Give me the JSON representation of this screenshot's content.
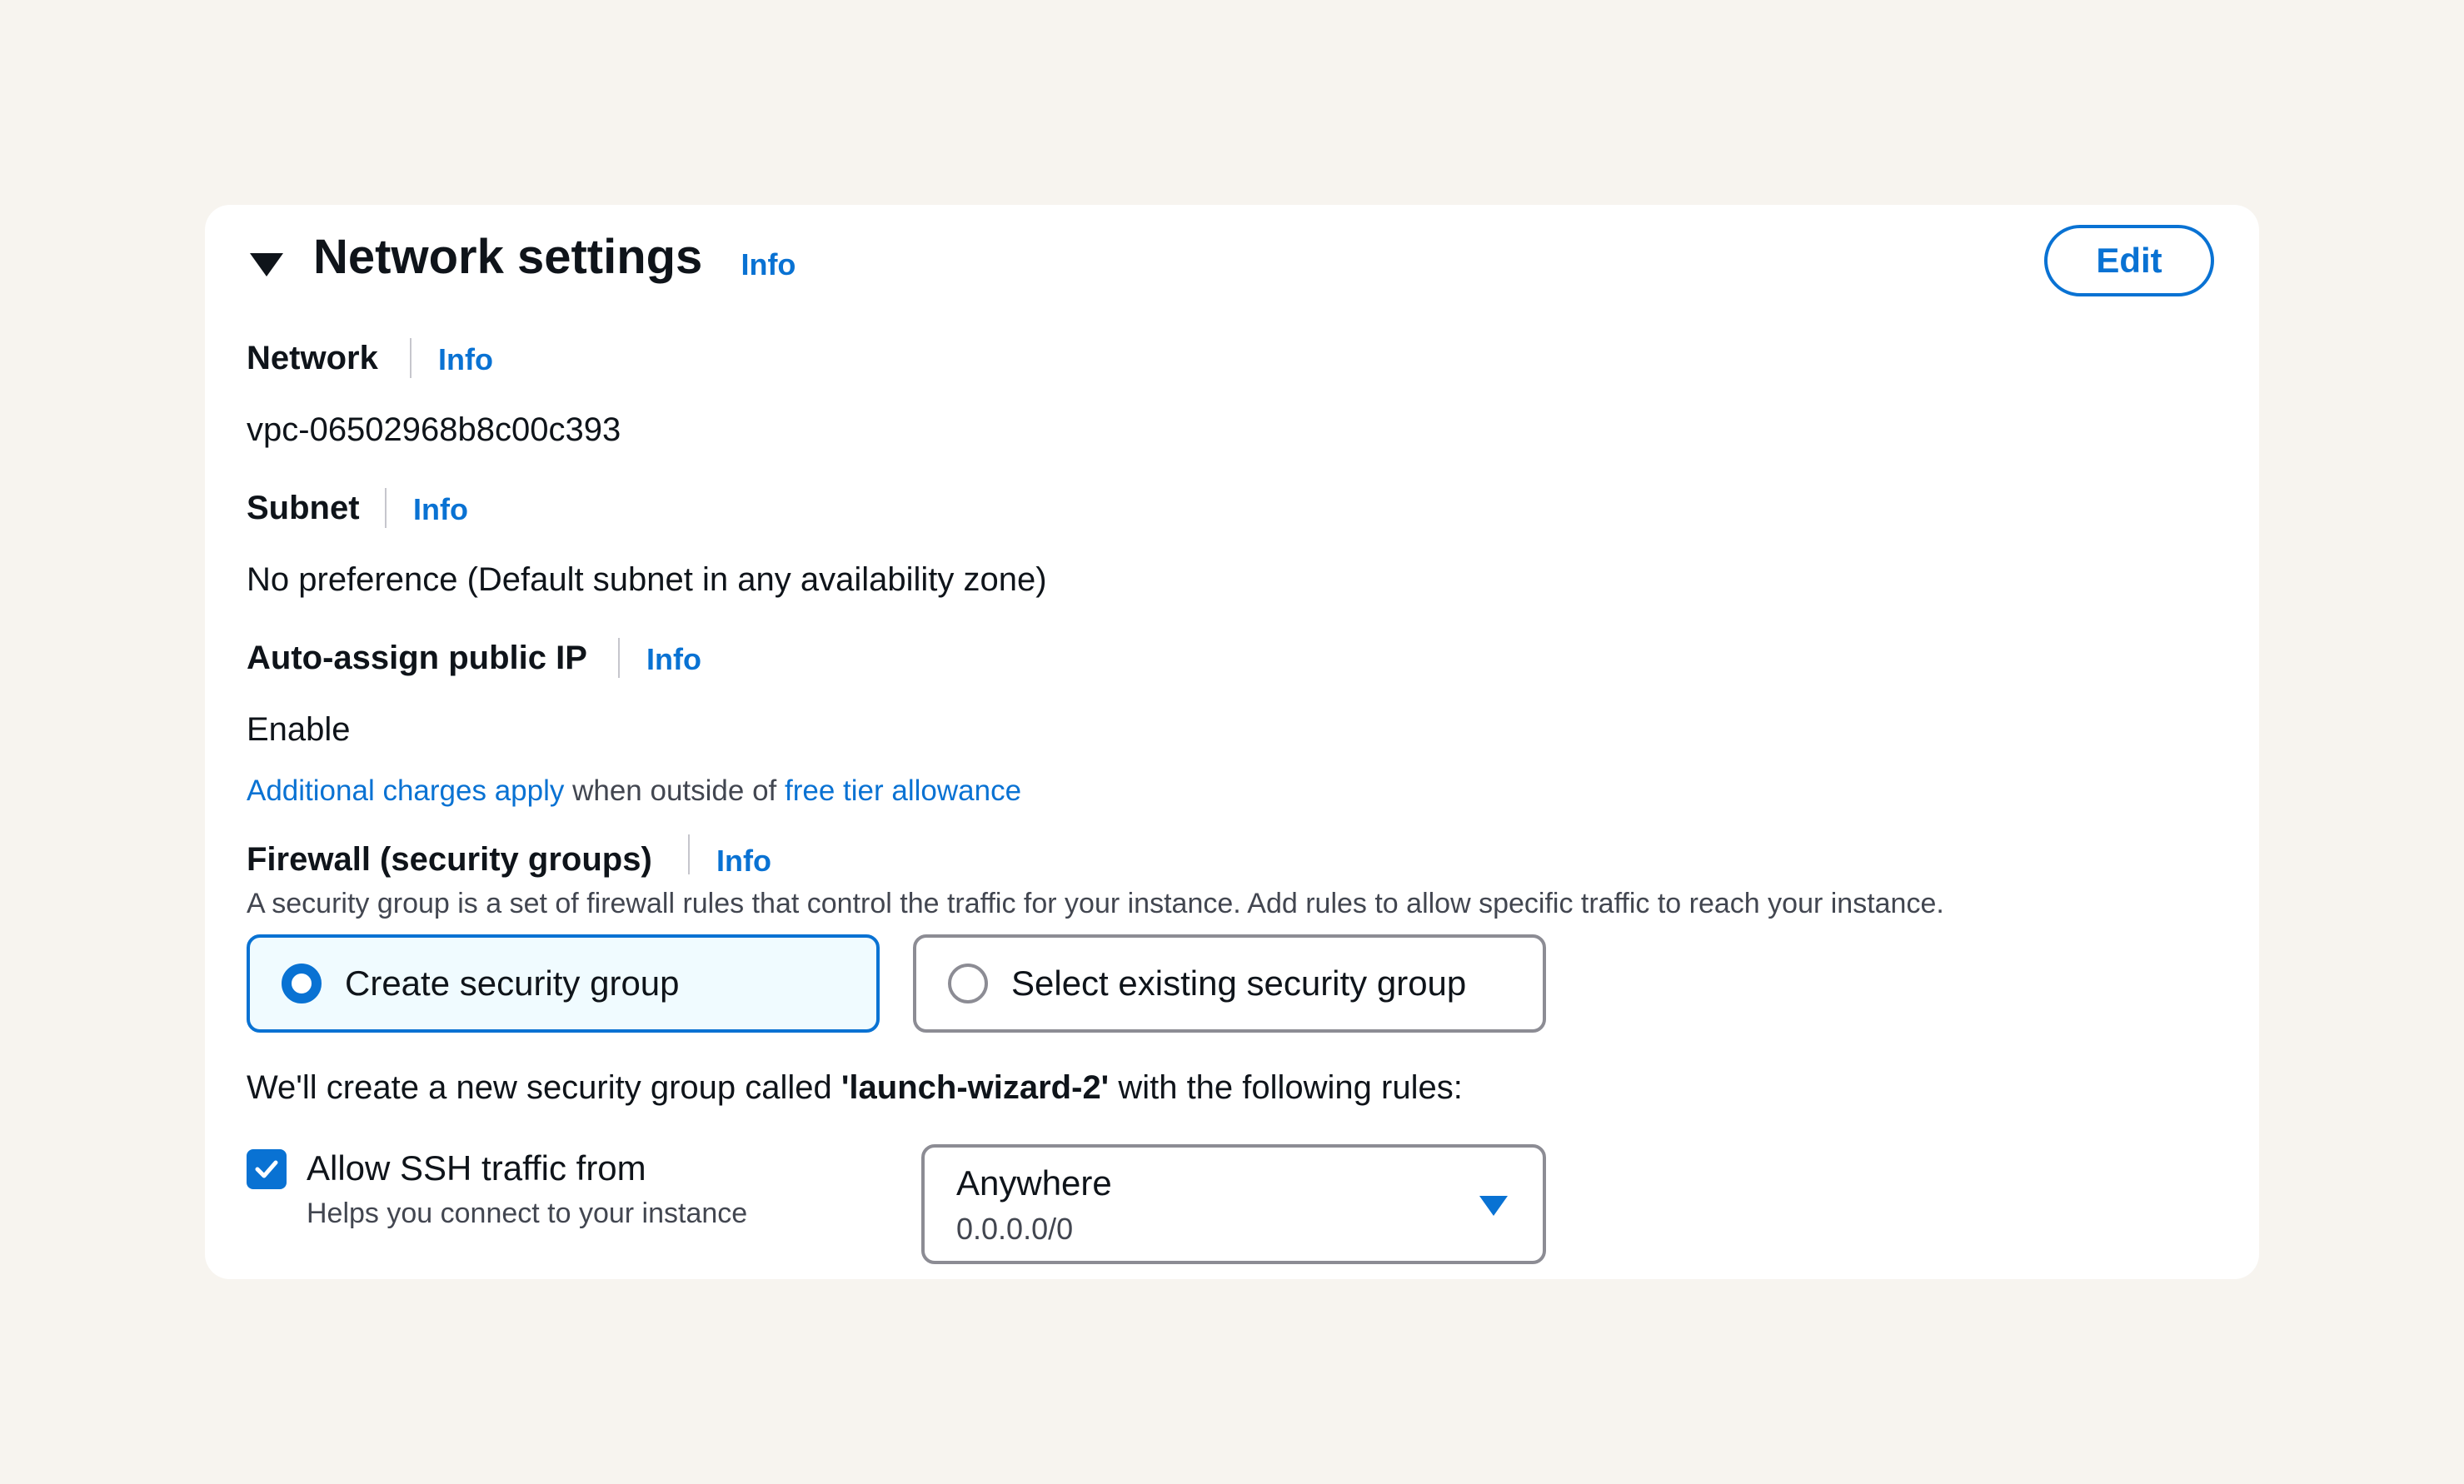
{
  "header": {
    "title": "Network settings",
    "info": "Info",
    "edit_label": "Edit"
  },
  "network": {
    "label": "Network",
    "info": "Info",
    "value": "vpc-06502968b8c00c393"
  },
  "subnet": {
    "label": "Subnet",
    "info": "Info",
    "value": "No preference (Default subnet in any availability zone)"
  },
  "public_ip": {
    "label": "Auto-assign public IP",
    "info": "Info",
    "value": "Enable",
    "charges_link": "Additional charges apply",
    "charges_text": " when outside of ",
    "free_tier_link": "free tier allowance"
  },
  "firewall": {
    "label": "Firewall (security groups)",
    "info": "Info",
    "description": "A security group is a set of firewall rules that control the traffic for your instance. Add rules to allow specific traffic to reach your instance.",
    "options": [
      {
        "label": "Create security group",
        "selected": true
      },
      {
        "label": "Select existing security group",
        "selected": false
      }
    ],
    "rules_prefix": "We'll create a new security group called ",
    "group_name": "'launch-wizard-2'",
    "rules_suffix": " with the following rules:"
  },
  "ssh_rule": {
    "checked": true,
    "label": "Allow SSH traffic from",
    "description": "Helps you connect to your instance",
    "source_value": "Anywhere",
    "source_cidr": "0.0.0.0/0"
  },
  "colors": {
    "accent": "#0972d3",
    "background": "#f7f4ef",
    "panel": "#ffffff",
    "selected_tile_bg": "#f0fbff"
  }
}
